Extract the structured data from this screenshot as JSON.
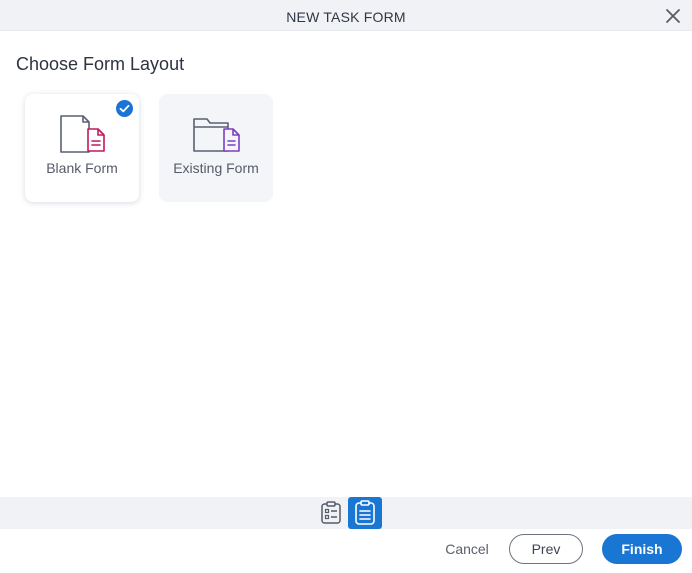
{
  "dialog": {
    "title": "NEW TASK FORM",
    "close_icon": "close-icon"
  },
  "section": {
    "title": "Choose Form Layout"
  },
  "options": [
    {
      "label": "Blank Form",
      "icon": "blank-form-icon",
      "selected": true
    },
    {
      "label": "Existing Form",
      "icon": "existing-form-icon",
      "selected": false
    }
  ],
  "steps": [
    {
      "icon": "checklist-icon",
      "active": false
    },
    {
      "icon": "clipboard-icon",
      "active": true
    }
  ],
  "footer": {
    "cancel_label": "Cancel",
    "prev_label": "Prev",
    "finish_label": "Finish"
  },
  "colors": {
    "accent": "#1976d2",
    "blank_doc": "#c2185b",
    "existing_doc": "#7b3fc4",
    "titlebar": "#f1f2f5"
  }
}
